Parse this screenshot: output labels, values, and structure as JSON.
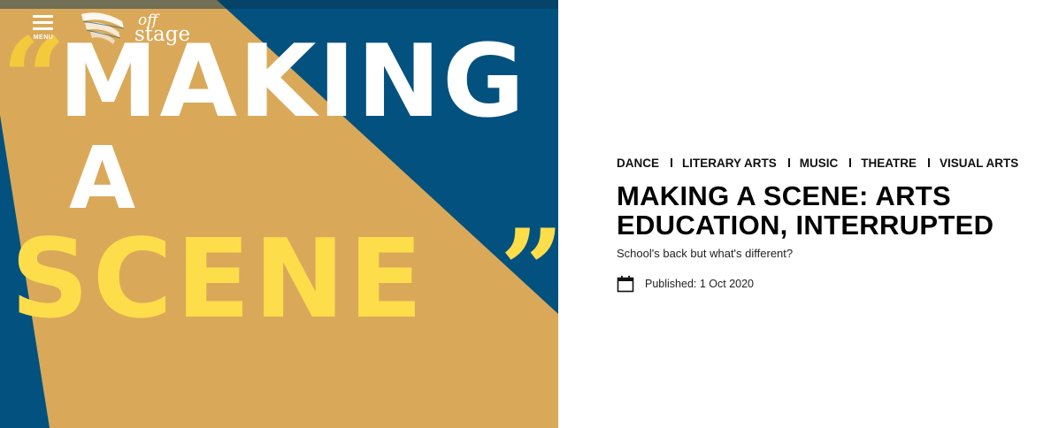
{
  "header": {
    "menu_label": "MENU",
    "logo": {
      "line1": "off",
      "line2": "stage"
    }
  },
  "hero": {
    "line1": "MAKING",
    "line2": "A",
    "line3": "SCENE",
    "open_quote": "“",
    "close_quote": "”"
  },
  "article": {
    "categories": [
      "DANCE",
      "LITERARY ARTS",
      "MUSIC",
      "THEATRE",
      "VISUAL ARTS"
    ],
    "title": "MAKING A SCENE: ARTS EDUCATION, INTERRUPTED",
    "subtitle": "School's back but what's different?",
    "published": "Published: 1 Oct 2020"
  },
  "colors": {
    "hero_blue": "#02517f",
    "spotlight_gold": "#d9a959",
    "scene_yellow": "#fedd4b",
    "quote_gold": "#f4c93c"
  },
  "icons": [
    "hamburger-menu-icon",
    "offstage-logo-mark",
    "calendar-icon"
  ]
}
